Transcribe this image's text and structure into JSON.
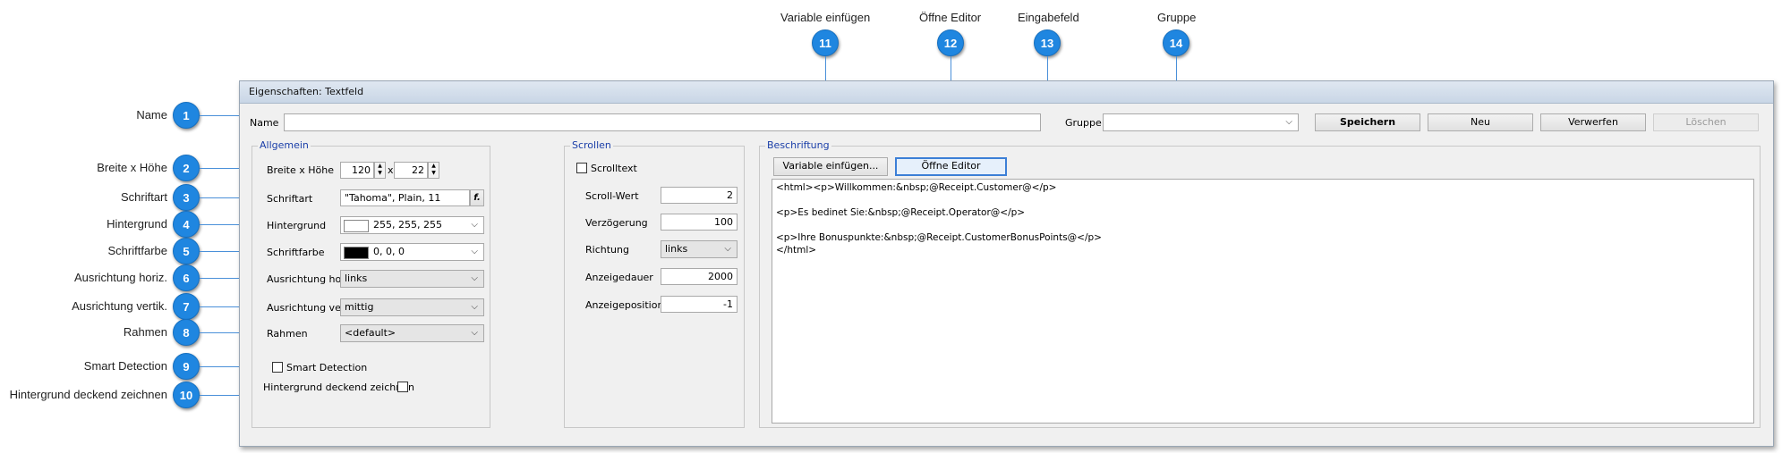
{
  "callouts_left": [
    {
      "num": "1",
      "label": "Name"
    },
    {
      "num": "2",
      "label": "Breite x Höhe"
    },
    {
      "num": "3",
      "label": "Schriftart"
    },
    {
      "num": "4",
      "label": "Hintergrund"
    },
    {
      "num": "5",
      "label": "Schriftfarbe"
    },
    {
      "num": "6",
      "label": "Ausrichtung horiz."
    },
    {
      "num": "7",
      "label": "Ausrichtung vertik."
    },
    {
      "num": "8",
      "label": "Rahmen"
    },
    {
      "num": "9",
      "label": "Smart Detection"
    },
    {
      "num": "10",
      "label": "Hintergrund deckend zeichnen"
    }
  ],
  "callouts_top": [
    {
      "num": "11",
      "label": "Variable einfügen"
    },
    {
      "num": "12",
      "label": "Öffne Editor"
    },
    {
      "num": "13",
      "label": "Eingabefeld"
    },
    {
      "num": "14",
      "label": "Gruppe"
    }
  ],
  "window": {
    "title": "Eigenschaften: Textfeld",
    "name_label": "Name",
    "name_value": "",
    "group_label": "Gruppe",
    "group_value": "",
    "buttons": {
      "save": "Speichern",
      "new": "Neu",
      "discard": "Verwerfen",
      "delete": "Löschen"
    }
  },
  "allgemein": {
    "title": "Allgemein",
    "size_label": "Breite x Höhe",
    "width": "120",
    "x_sep": "x",
    "height": "22",
    "font_label": "Schriftart",
    "font_value": "\"Tahoma\", Plain, 11",
    "font_btn": "f.",
    "bg_label": "Hintergrund",
    "bg_value": "255, 255, 255",
    "bg_color": "#ffffff",
    "fg_label": "Schriftfarbe",
    "fg_value": "0, 0, 0",
    "fg_color": "#000000",
    "halign_label": "Ausrichtung horiz.",
    "halign_value": "links",
    "valign_label": "Ausrichtung vertik.",
    "valign_value": "mittig",
    "border_label": "Rahmen",
    "border_value": "<default>",
    "smart_label": "Smart Detection",
    "opaque_label": "Hintergrund deckend zeichnen"
  },
  "scrollen": {
    "title": "Scrollen",
    "scrolltext_label": "Scrolltext",
    "scroll_value_label": "Scroll-Wert",
    "scroll_value": "2",
    "delay_label": "Verzögerung",
    "delay_value": "100",
    "direction_label": "Richtung",
    "direction_value": "links",
    "duration_label": "Anzeigedauer",
    "duration_value": "2000",
    "position_label": "Anzeigeposition",
    "position_value": "-1"
  },
  "beschriftung": {
    "title": "Beschriftung",
    "insert_var_btn": "Variable einfügen...",
    "open_editor_btn": "Öffne Editor",
    "lines": [
      "<html><p>Willkommen:&nbsp;@Receipt.Customer@</p>",
      "",
      "<p>Es bedinet Sie:&nbsp;@Receipt.Operator@</p>",
      "",
      "<p>Ihre Bonuspunkte:&nbsp;@Receipt.CustomerBonusPoints@</p>",
      "</html>"
    ]
  },
  "icons": {
    "spin_up": "▲",
    "spin_down": "▼",
    "dropdown": "⌵"
  }
}
